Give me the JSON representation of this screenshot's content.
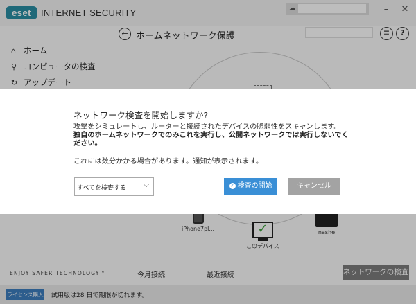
{
  "app": {
    "logo": "eset",
    "product_name": "INTERNET SECURITY",
    "window_controls": {
      "minimize": "–",
      "close": "✕"
    }
  },
  "header": {
    "title": "ホームネットワーク保護",
    "icons": [
      "back-icon",
      "menu-icon",
      "help-icon"
    ]
  },
  "sidebar": {
    "items": [
      {
        "label": "ホーム",
        "icon": "home-icon"
      },
      {
        "label": "コンピュータの検査",
        "icon": "search-icon"
      },
      {
        "label": "アップデート",
        "icon": "refresh-icon"
      }
    ],
    "tagline": "ENJOY SAFER TECHNOLOGY™"
  },
  "network": {
    "devices": [
      {
        "label": "iPhone7pl...",
        "icon": "phone-icon"
      },
      {
        "label": "このデバイス",
        "icon": "monitor-icon"
      },
      {
        "label": "nashe",
        "icon": "nas-icon"
      }
    ]
  },
  "bottom": {
    "tabs": [
      "今月接続",
      "最近接続"
    ],
    "scan_network_button": "ネットワークの検査"
  },
  "footer": {
    "buy_button": "ライセンス購入",
    "trial_text": "試用版は28 日で期限が切れます。"
  },
  "dialog": {
    "title": "ネットワーク検査を開始しますか?",
    "description": "攻撃をシミュレートし、ルーターと接続されたデバイスの脆弱性をスキャンします。",
    "warning": "独自のホームネットワークでのみこれを実行し、公開ネットワークでは実行しないでください。",
    "note": "これには数分かかる場合があります。通知が表示されます。",
    "scan_select": {
      "value": "すべてを検査する"
    },
    "start_button": "検査の開始",
    "cancel_button": "キャンセル"
  },
  "colors": {
    "brand": "#2a8ea4",
    "primary_button": "#3a8fd6",
    "secondary_button": "#a3a3a3",
    "status_ok": "#3aa13a"
  }
}
